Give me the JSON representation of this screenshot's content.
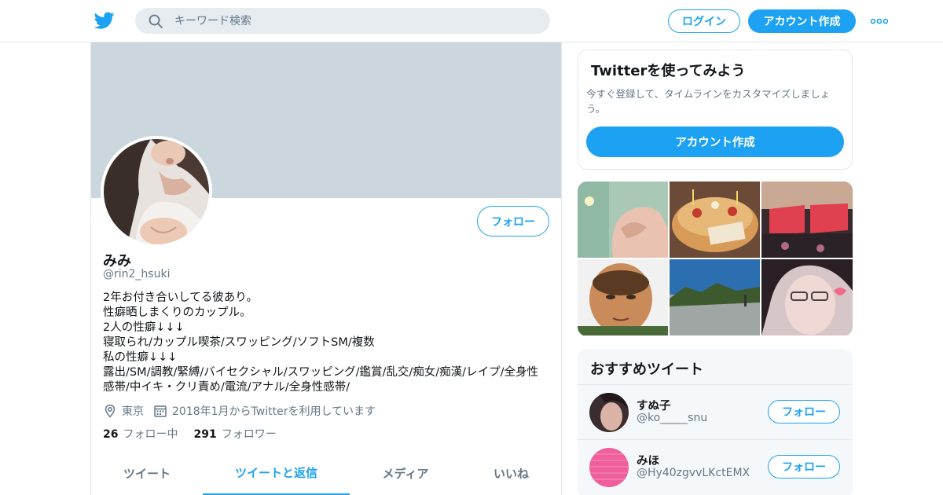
{
  "header": {
    "logo_icon": "twitter-bird-icon",
    "search_placeholder": "キーワード検索",
    "login_label": "ログイン",
    "signup_label": "アカウント作成",
    "more_icon": "more-dots-icon",
    "accent_color": "#1da1f2"
  },
  "profile": {
    "name": "みみ",
    "handle": "@rin2_hsuki",
    "follow_label": "フォロー",
    "bio_lines": [
      "2年お付き合いしてる彼あり。",
      "性癖晒しまくりのカップル。",
      "2人の性癖↓↓↓",
      "寝取られ/カップル喫茶/スワッピング/ソフトSM/複数",
      "私の性癖↓↓↓",
      "露出/SM/調教/緊縛/バイセクシャル/スワッピング/鑑賞/乱交/痴女/痴漢/レイプ/全身性",
      "感帯/中イキ・クリ責め/電流/アナル/全身性感帯/"
    ],
    "location": "東京",
    "joined": "2018年1月からTwitterを利用しています",
    "following_count": "26",
    "following_label": "フォロー中",
    "followers_count": "291",
    "followers_label": "フォロワー",
    "tabs": [
      "ツイート",
      "ツイートと返信",
      "メディア",
      "いいね"
    ],
    "active_tab": "ツイートと返信"
  },
  "signup_card": {
    "title": "Twitterを使ってみよう",
    "description": "今すぐ登録して、タイムラインをカスタマイズしましょう。",
    "button_label": "アカウント作成"
  },
  "recommended": {
    "title": "おすすめツイート",
    "users": [
      {
        "name": "すぬ子",
        "handle": "@ko_____snu",
        "follow_label": "フォロー"
      },
      {
        "name": "みほ",
        "handle": "@Hy40zgvvLKctEMX",
        "follow_label": "フォロー"
      }
    ]
  }
}
